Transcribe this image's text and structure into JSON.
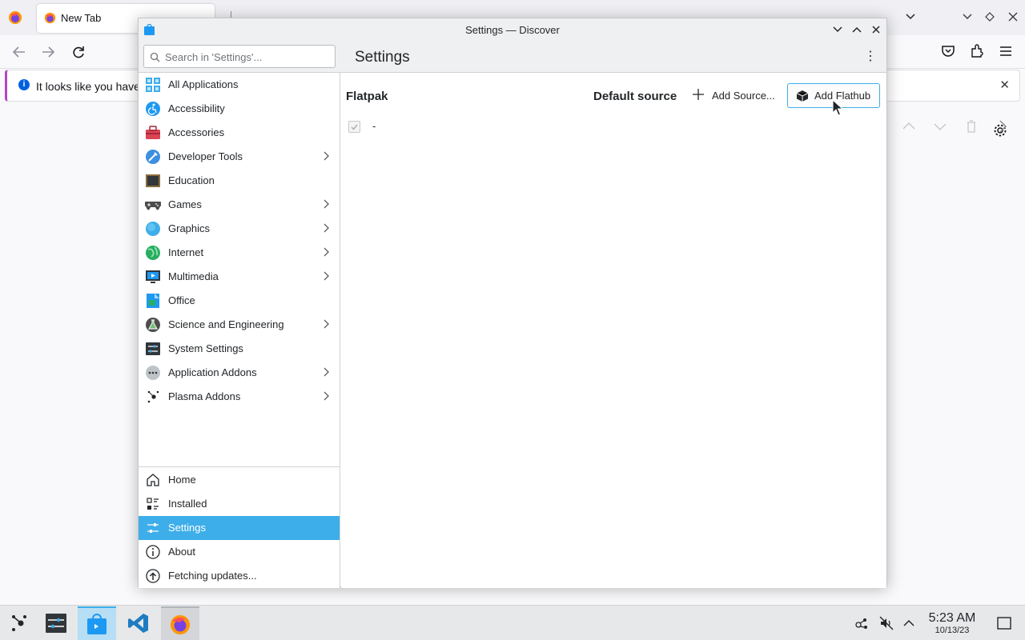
{
  "browser": {
    "tab_title": "New Tab",
    "tab_close": "×",
    "tab_dropdown": "⌄",
    "notice_text": "It looks like you have",
    "notice_close": "✕"
  },
  "window": {
    "title": "Settings — Discover"
  },
  "header": {
    "search_placeholder": "Search in 'Settings'...",
    "page_title": "Settings",
    "menu_glyph": "⋮"
  },
  "sidebar": {
    "categories": [
      {
        "label": "All Applications",
        "icon": "grid-icon"
      },
      {
        "label": "Accessibility",
        "icon": "accessibility-icon"
      },
      {
        "label": "Accessories",
        "icon": "toolbox-icon"
      },
      {
        "label": "Developer Tools",
        "icon": "developer-tools-icon"
      },
      {
        "label": "Education",
        "icon": "chalkboard-icon"
      },
      {
        "label": "Games",
        "icon": "gamepad-icon"
      },
      {
        "label": "Graphics",
        "icon": "graphics-icon"
      },
      {
        "label": "Internet",
        "icon": "globe-icon"
      },
      {
        "label": "Multimedia",
        "icon": "monitor-icon"
      },
      {
        "label": "Office",
        "icon": "office-icon"
      },
      {
        "label": "Science and Engineering",
        "icon": "flask-icon"
      },
      {
        "label": "System Settings",
        "icon": "system-settings-icon"
      },
      {
        "label": "Application Addons",
        "icon": "addons-icon"
      },
      {
        "label": "Plasma Addons",
        "icon": "plasma-icon"
      }
    ],
    "nav": [
      {
        "label": "Home",
        "icon": "home-icon"
      },
      {
        "label": "Installed",
        "icon": "installed-icon"
      },
      {
        "label": "Settings",
        "icon": "settings-sliders-icon",
        "active": true
      },
      {
        "label": "About",
        "icon": "info-icon"
      },
      {
        "label": "Fetching updates...",
        "icon": "update-icon"
      }
    ]
  },
  "main": {
    "source_title": "Flatpak",
    "default_source_label": "Default source",
    "add_source_label": "Add Source...",
    "add_flathub_label": "Add Flathub",
    "row_name": "-"
  },
  "taskbar": {
    "time": "5:23 AM",
    "date": "10/13/23"
  },
  "colors": {
    "accent": "#3daee9",
    "selection_text": "#ffffff",
    "firefox_accent": "#b146c2"
  }
}
